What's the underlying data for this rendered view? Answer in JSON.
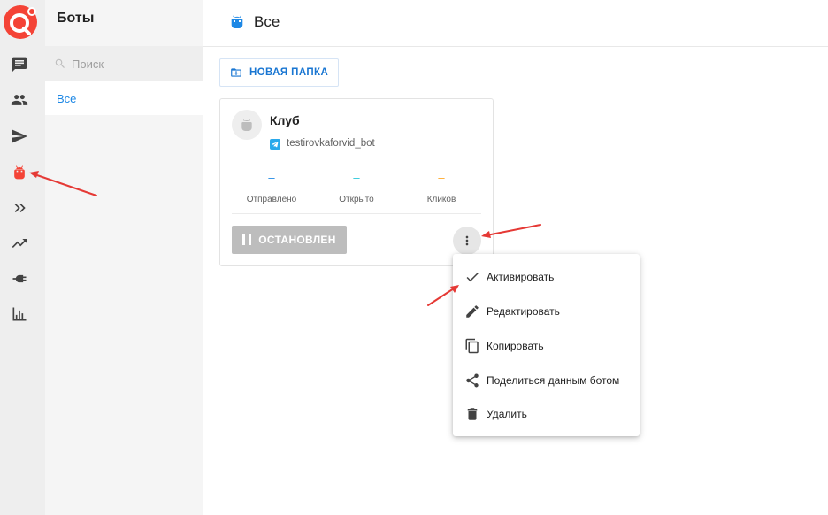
{
  "sidebar": {
    "title": "Боты",
    "search_placeholder": "Поиск",
    "folders": [
      {
        "label": "Все"
      }
    ],
    "rail_icons": [
      "chat-icon",
      "people-icon",
      "send-icon",
      "bot-icon",
      "forward-icon",
      "trending-icon",
      "plug-icon",
      "bar-chart-icon"
    ]
  },
  "header": {
    "title": "Все"
  },
  "toolbar": {
    "new_folder_label": "НОВАЯ ПАПКА"
  },
  "bot_card": {
    "name": "Клуб",
    "username": "testirovkaforvid_bot",
    "stats": [
      {
        "label": "Отправлено",
        "value": "–",
        "color": "#1e88e5"
      },
      {
        "label": "Открыто",
        "value": "–",
        "color": "#26c6da"
      },
      {
        "label": "Кликов",
        "value": "–",
        "color": "#ffa726"
      }
    ],
    "status_label": "ОСТАНОВЛЕН"
  },
  "context_menu": {
    "items": [
      {
        "label": "Активировать",
        "icon": "check-icon"
      },
      {
        "label": "Редактировать",
        "icon": "pencil-icon"
      },
      {
        "label": "Копировать",
        "icon": "copy-icon"
      },
      {
        "label": "Поделиться данным ботом",
        "icon": "share-icon"
      },
      {
        "label": "Удалить",
        "icon": "trash-icon"
      }
    ]
  },
  "colors": {
    "brand": "#f44336",
    "accent": "#1976d2",
    "annotation_arrow": "#e53935"
  }
}
